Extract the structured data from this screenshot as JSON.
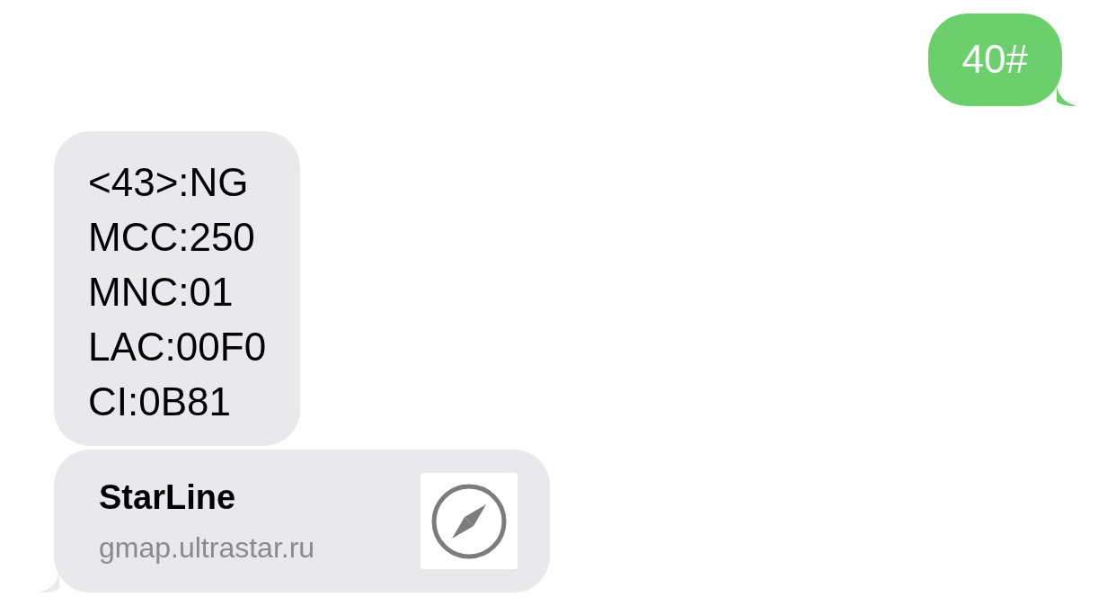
{
  "messages": [
    {
      "kind": "text",
      "outgoing": true,
      "text": "40#"
    },
    {
      "kind": "text",
      "outgoing": false,
      "text": "<43>:NG\nMCC:250\nMNC:01\nLAC:00F0\nCI:0B81"
    },
    {
      "kind": "link",
      "outgoing": false,
      "title": "StarLine",
      "url": "gmap.ultrastar.ru"
    }
  ]
}
